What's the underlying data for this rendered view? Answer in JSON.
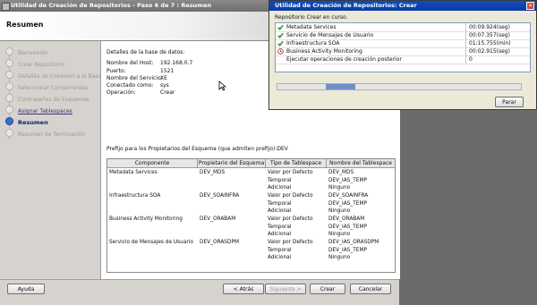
{
  "window": {
    "title": "Utilidad de Creación de Repositorios - Paso 6 de 7 : Resumen"
  },
  "header": {
    "title": "Resumen"
  },
  "nav": {
    "items": [
      {
        "label": "Bienvenido",
        "state": "done"
      },
      {
        "label": "Crear Repositorio",
        "state": "done"
      },
      {
        "label": "Detalles de Conexión a la Base de",
        "state": "done"
      },
      {
        "label": "Seleccionar Componentes",
        "state": "done"
      },
      {
        "label": "Contraseñas de Esquemas",
        "state": "done"
      },
      {
        "label": "Asignar Tablespaces",
        "state": "link"
      },
      {
        "label": "Resumen",
        "state": "current"
      },
      {
        "label": "Resumen de Terminación",
        "state": "pending"
      }
    ]
  },
  "details": {
    "heading": "Detalles de la base de datos:",
    "rows": [
      {
        "label": "Nombre del Host:",
        "value": "192.168.0.7"
      },
      {
        "label": "Puerto:",
        "value": "1521"
      },
      {
        "label": "Nombre del Servicio:",
        "value": "XE"
      },
      {
        "label": "Conectado como:",
        "value": "sys"
      },
      {
        "label": "Operación:",
        "value": "Crear"
      }
    ],
    "prefix_line": "Prefijo para los Propietarios del Esquema (que admiten prefijo):DEV"
  },
  "table": {
    "headers": [
      "Componente",
      "Propietario del Esquema",
      "Tipo de Tablespace",
      "Nombre del Tablespace"
    ],
    "groups": [
      {
        "component": "Metadata Services",
        "owner": "DEV_MDS",
        "rows": [
          [
            "Valor por Defecto",
            "DEV_MDS"
          ],
          [
            "Temporal",
            "DEV_IAS_TEMP"
          ],
          [
            "Adicional",
            "Ninguno"
          ]
        ]
      },
      {
        "component": "Infraestructura SOA",
        "owner": "DEV_SOAINFRA",
        "rows": [
          [
            "Valor por Defecto",
            "DEV_SOAINFRA"
          ],
          [
            "Temporal",
            "DEV_IAS_TEMP"
          ],
          [
            "Adicional",
            "Ninguno"
          ]
        ]
      },
      {
        "component": "Business Activity Monitoring",
        "owner": "DEV_ORABAM",
        "rows": [
          [
            "Valor por Defecto",
            "DEV_ORABAM"
          ],
          [
            "Temporal",
            "DEV_IAS_TEMP"
          ],
          [
            "Adicional",
            "Ninguno"
          ]
        ]
      },
      {
        "component": "Servicio de Mensajes de Usuario",
        "owner": "DEV_ORASDPM",
        "rows": [
          [
            "Valor por Defecto",
            "DEV_IAS_ORASDPM"
          ],
          [
            "Temporal",
            "DEV_IAS_TEMP"
          ],
          [
            "Adicional",
            "Ninguno"
          ]
        ]
      }
    ]
  },
  "footer": {
    "help": "Ayuda",
    "back": "< Atrás",
    "next": "Siguiente >",
    "create": "Crear",
    "cancel": "Cancelar"
  },
  "dialog": {
    "title": "Utilidad de Creación de Repositorios: Crear",
    "status": "Repositorio Crear en curso.",
    "operations": [
      {
        "name": "Metadata Services",
        "time": "00:09.924(seg)",
        "icon": "check-icon"
      },
      {
        "name": "Servicio de Mensajes de Usuario",
        "time": "00:07.357(seg)",
        "icon": "check-icon"
      },
      {
        "name": "Infraestructura SOA",
        "time": "01:15.755(min)",
        "icon": "check-icon"
      },
      {
        "name": "Business Activity Monitoring",
        "time": "00:02.915(seg)",
        "icon": "clock-icon"
      },
      {
        "name": "Ejecutar operaciones de creación posterior",
        "time": "0",
        "icon": "none"
      }
    ],
    "progress_fraction": 0.12,
    "stop": "Parar"
  }
}
